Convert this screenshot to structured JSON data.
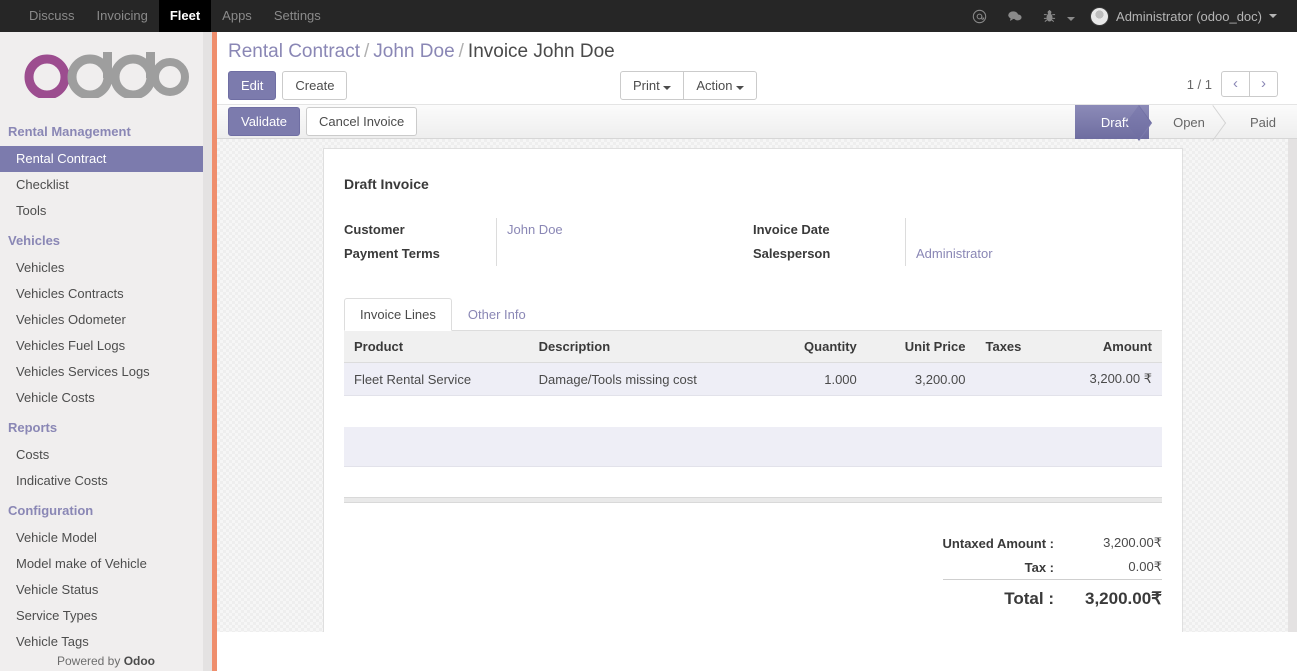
{
  "colors": {
    "accent": "#7c7bad",
    "topbar_bg": "#262626",
    "sidebar_bg": "#f0eeee",
    "rail_orange": "#ef8e6d",
    "row_lavender": "#eeeef6",
    "link": "#8a87b5"
  },
  "topbar": {
    "menu": [
      {
        "label": "Discuss",
        "active": false
      },
      {
        "label": "Invoicing",
        "active": false
      },
      {
        "label": "Fleet",
        "active": true
      },
      {
        "label": "Apps",
        "active": false
      },
      {
        "label": "Settings",
        "active": false
      }
    ],
    "icons": [
      {
        "name": "mention-icon",
        "glyph": "@"
      },
      {
        "name": "chat-bubble-icon",
        "glyph": "✉"
      },
      {
        "name": "debug-bug-icon",
        "glyph": "☣"
      }
    ],
    "user": "Administrator (odoo_doc)"
  },
  "sidebar": {
    "logo_text": "odoo",
    "sections": [
      {
        "title": "Rental Management",
        "items": [
          {
            "label": "Rental Contract",
            "active": true
          },
          {
            "label": "Checklist",
            "active": false
          },
          {
            "label": "Tools",
            "active": false
          }
        ]
      },
      {
        "title": "Vehicles",
        "items": [
          {
            "label": "Vehicles",
            "active": false
          },
          {
            "label": "Vehicles Contracts",
            "active": false
          },
          {
            "label": "Vehicles Odometer",
            "active": false
          },
          {
            "label": "Vehicles Fuel Logs",
            "active": false
          },
          {
            "label": "Vehicles Services Logs",
            "active": false
          },
          {
            "label": "Vehicle Costs",
            "active": false
          }
        ]
      },
      {
        "title": "Reports",
        "items": [
          {
            "label": "Costs",
            "active": false
          },
          {
            "label": "Indicative Costs",
            "active": false
          }
        ]
      },
      {
        "title": "Configuration",
        "items": [
          {
            "label": "Vehicle Model",
            "active": false
          },
          {
            "label": "Model make of Vehicle",
            "active": false
          },
          {
            "label": "Vehicle Status",
            "active": false
          },
          {
            "label": "Service Types",
            "active": false
          },
          {
            "label": "Vehicle Tags",
            "active": false
          }
        ]
      }
    ],
    "footer_prefix": "Powered by ",
    "footer_brand": "Odoo"
  },
  "breadcrumb": {
    "items": [
      {
        "label": "Rental Contract",
        "active": false
      },
      {
        "label": "John Doe",
        "active": false
      },
      {
        "label": "Invoice John Doe",
        "active": true
      }
    ],
    "separator": "/"
  },
  "toolbar": {
    "edit_label": "Edit",
    "create_label": "Create",
    "print_label": "Print",
    "action_label": "Action"
  },
  "pager": {
    "count": "1 / 1",
    "prev_glyph": "‹",
    "next_glyph": "›"
  },
  "statusbar": {
    "buttons": [
      {
        "label": "Validate",
        "primary": true
      },
      {
        "label": "Cancel Invoice",
        "primary": false
      }
    ],
    "stages": [
      {
        "label": "Draft",
        "active": true
      },
      {
        "label": "Open",
        "active": false
      },
      {
        "label": "Paid",
        "active": false
      }
    ]
  },
  "form": {
    "title": "Draft Invoice",
    "left_fields": [
      {
        "name": "Customer",
        "value": "John Doe",
        "is_link": true
      },
      {
        "name": "Payment Terms",
        "value": "",
        "is_link": false
      }
    ],
    "right_fields": [
      {
        "name": "Invoice Date",
        "value": "",
        "is_link": false
      },
      {
        "name": "Salesperson",
        "value": "Administrator",
        "is_link": true
      }
    ],
    "tabs": [
      {
        "label": "Invoice Lines",
        "active": true
      },
      {
        "label": "Other Info",
        "active": false
      }
    ],
    "table": {
      "columns": [
        "Product",
        "Description",
        "Quantity",
        "Unit Price",
        "Taxes",
        "Amount"
      ],
      "rows": [
        {
          "product": "Fleet Rental Service",
          "description": "Damage/Tools missing cost",
          "quantity": "1.000",
          "unit_price": "3,200.00",
          "taxes": "",
          "amount": "3,200.00 ₹"
        }
      ]
    },
    "totals": [
      {
        "label": "Untaxed Amount :",
        "value": "3,200.00₹",
        "grand": false
      },
      {
        "label": "Tax :",
        "value": "0.00₹",
        "grand": false
      },
      {
        "label": "Total :",
        "value": "3,200.00₹",
        "grand": true
      }
    ]
  }
}
